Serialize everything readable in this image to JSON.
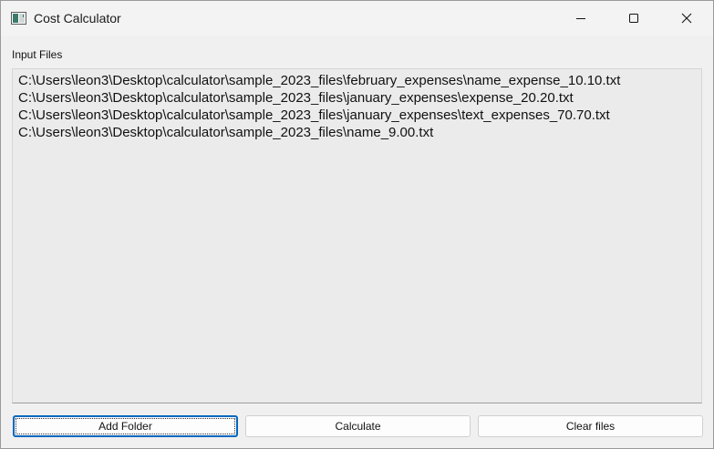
{
  "window": {
    "title": "Cost Calculator",
    "icon": "app-window-icon",
    "controls": {
      "minimize_icon": "minimize-icon",
      "maximize_icon": "maximize-icon",
      "close_icon": "close-icon"
    }
  },
  "input_files": {
    "label": "Input Files",
    "items": [
      "C:\\Users\\leon3\\Desktop\\calculator\\sample_2023_files\\february_expenses\\name_expense_10.10.txt",
      "C:\\Users\\leon3\\Desktop\\calculator\\sample_2023_files\\january_expenses\\expense_20.20.txt",
      "C:\\Users\\leon3\\Desktop\\calculator\\sample_2023_files\\january_expenses\\text_expenses_70.70.txt",
      "C:\\Users\\leon3\\Desktop\\calculator\\sample_2023_files\\name_9.00.txt"
    ]
  },
  "buttons": {
    "add_folder": "Add Folder",
    "calculate": "Calculate",
    "clear_files": "Clear files"
  },
  "colors": {
    "focus_border": "#0067c0",
    "window_bg": "#f0f0f0",
    "list_bg": "#ebebeb"
  }
}
